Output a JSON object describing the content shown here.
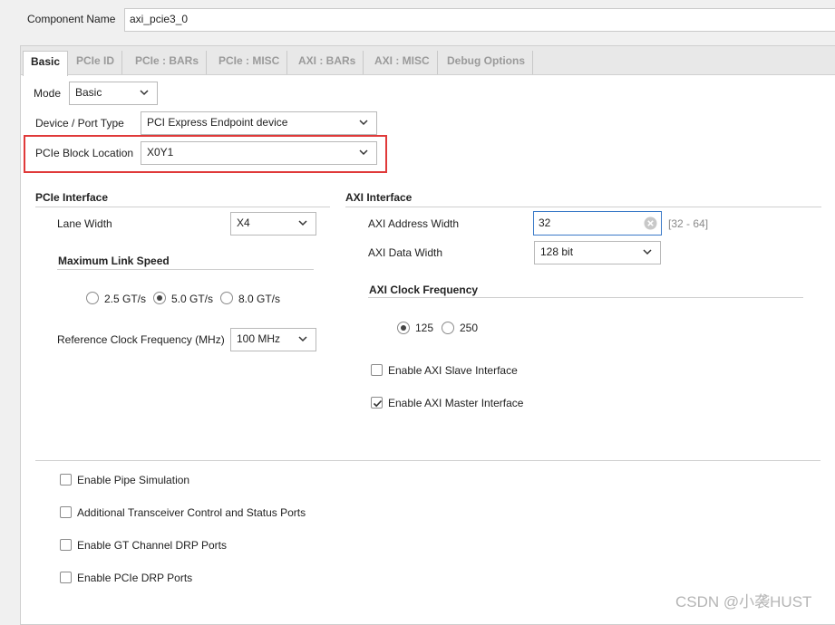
{
  "component": {
    "label": "Component Name",
    "value": "axi_pcie3_0"
  },
  "tabs": [
    {
      "label": "Basic",
      "active": true
    },
    {
      "label": "PCIe ID"
    },
    {
      "label": "PCIe : BARs"
    },
    {
      "label": "PCIe : MISC"
    },
    {
      "label": "AXI : BARs"
    },
    {
      "label": "AXI : MISC"
    },
    {
      "label": "Debug Options"
    }
  ],
  "basic": {
    "mode_label": "Mode",
    "mode_value": "Basic",
    "device_label": "Device / Port Type",
    "device_value": "PCI Express Endpoint device",
    "block_label": "PCIe Block Location",
    "block_value": "X0Y1"
  },
  "pcie_interface": {
    "title": "PCIe Interface",
    "lane_width_label": "Lane Width",
    "lane_width_value": "X4",
    "link_speed_title": "Maximum Link Speed",
    "speeds": [
      {
        "label": "2.5 GT/s",
        "checked": false
      },
      {
        "label": "5.0 GT/s",
        "checked": true
      },
      {
        "label": "8.0 GT/s",
        "checked": false
      }
    ],
    "ref_clock_label": "Reference Clock Frequency (MHz)",
    "ref_clock_value": "100 MHz"
  },
  "axi_interface": {
    "title": "AXI Interface",
    "addr_width_label": "AXI Address Width",
    "addr_width_value": "32",
    "addr_width_range": "[32 - 64]",
    "data_width_label": "AXI Data Width",
    "data_width_value": "128 bit",
    "clock_title": "AXI Clock Frequency",
    "clocks": [
      {
        "label": "125",
        "checked": true
      },
      {
        "label": "250",
        "checked": false
      }
    ],
    "slave_label": "Enable AXI Slave Interface",
    "slave_checked": false,
    "master_label": "Enable AXI Master Interface",
    "master_checked": true
  },
  "options": [
    {
      "label": "Enable Pipe Simulation",
      "checked": false
    },
    {
      "label": "Additional Transceiver Control and Status Ports",
      "checked": false
    },
    {
      "label": "Enable GT Channel DRP Ports",
      "checked": false
    },
    {
      "label": "Enable PCIe DRP Ports",
      "checked": false
    }
  ],
  "watermark": "CSDN @小袭HUST",
  "colors": {
    "highlight": "#e03a3a",
    "focus": "#3a7ac8"
  }
}
